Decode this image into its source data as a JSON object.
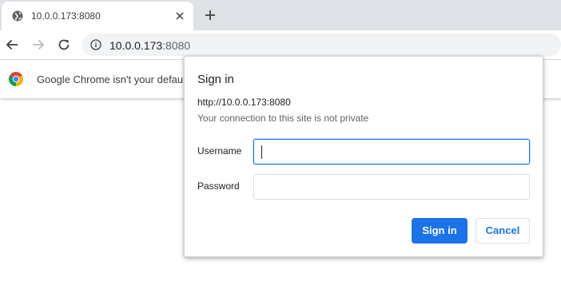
{
  "tab": {
    "title": "10.0.0.173:8080",
    "favicon": "globe-icon"
  },
  "toolbar": {
    "url_host": "10.0.0.173",
    "url_port": ":8080"
  },
  "infobar": {
    "text": "Google Chrome isn't your defaul"
  },
  "dialog": {
    "title": "Sign in",
    "origin": "http://10.0.0.173:8080",
    "warning": "Your connection to this site is not private",
    "username_label": "Username",
    "username_value": "",
    "password_label": "Password",
    "password_value": "",
    "sign_in_label": "Sign in",
    "cancel_label": "Cancel"
  },
  "colors": {
    "accent": "#1a73e8",
    "tabstrip": "#dee1e6",
    "omnibox": "#f1f3f4"
  }
}
